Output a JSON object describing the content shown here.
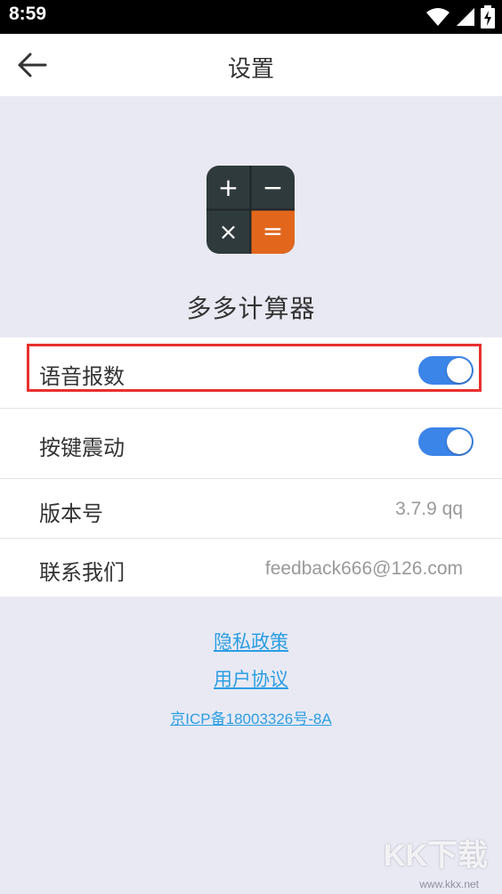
{
  "status_bar": {
    "time": "8:59"
  },
  "app_bar": {
    "title": "设置"
  },
  "app_info": {
    "name": "多多计算器",
    "logo_keys": [
      "+",
      "−",
      "×",
      "="
    ]
  },
  "settings": {
    "voice_report": {
      "label": "语音报数",
      "enabled": true
    },
    "key_vibration": {
      "label": "按键震动",
      "enabled": true
    },
    "version": {
      "label": "版本号",
      "value": "3.7.9  qq"
    },
    "contact": {
      "label": "联系我们",
      "value": "feedback666@126.com"
    }
  },
  "links": {
    "privacy": "隐私政策",
    "agreement": "用户协议",
    "icp": "京ICP备18003326号-8A"
  },
  "watermark": {
    "logo_text": "KK下载",
    "url": "www.kkx.net"
  },
  "colors": {
    "accent": "#3b84e8",
    "link": "#2b9ee2",
    "highlight": "#e8302f",
    "logo_equals": "#e2671d",
    "logo_keys_bg": "#2f3a3d"
  }
}
